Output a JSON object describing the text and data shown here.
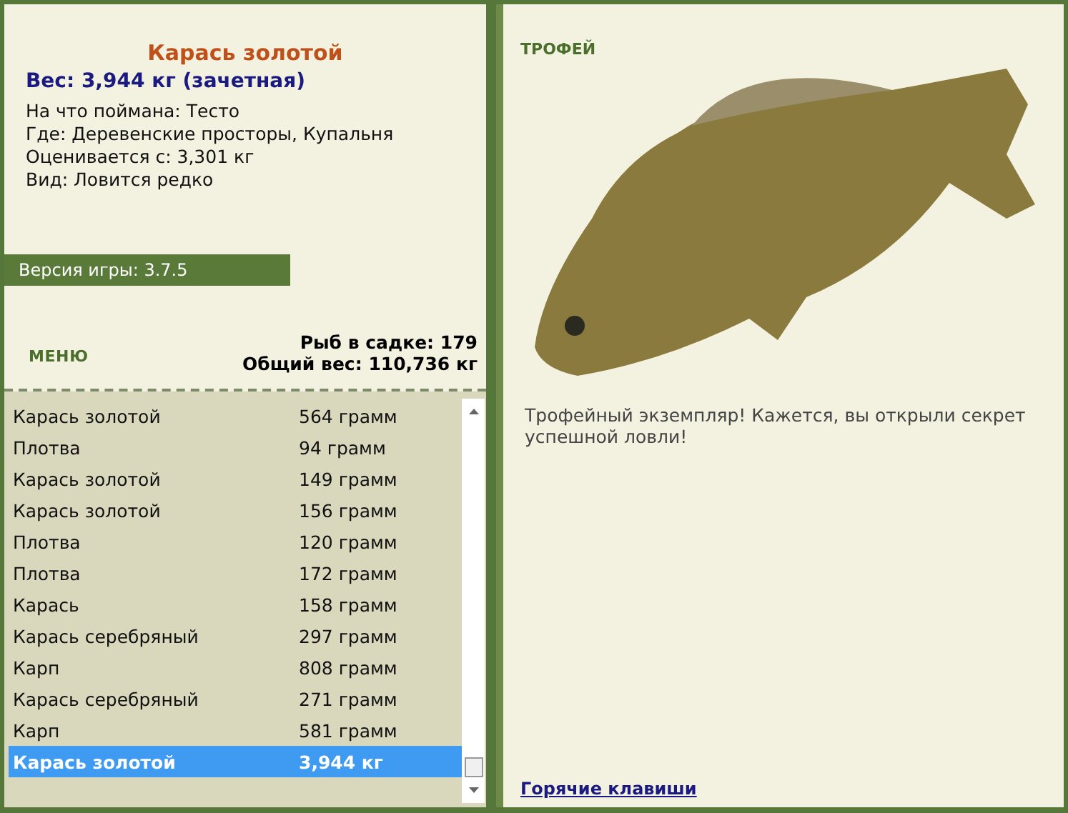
{
  "catch": {
    "title": "Карась золотой",
    "weight": "Вес: 3,944 кг (зачетная)",
    "details": [
      "На что поймана: Тесто",
      "Где: Деревенские просторы, Купальня",
      "Оценивается с: 3,301 кг",
      "Вид: Ловится редко"
    ]
  },
  "version": "Версия игры: 3.7.5",
  "menu_button": "МЕНЮ",
  "stats": [
    "Рыб в садке: 179",
    "Общий вес: 110,736 кг"
  ],
  "fish_list": [
    {
      "name": "Карась золотой",
      "weight": "564 грамм",
      "selected": false
    },
    {
      "name": "Плотва",
      "weight": "94 грамм",
      "selected": false
    },
    {
      "name": "Карась золотой",
      "weight": "149 грамм",
      "selected": false
    },
    {
      "name": "Карась золотой",
      "weight": "156 грамм",
      "selected": false
    },
    {
      "name": "Плотва",
      "weight": "120 грамм",
      "selected": false
    },
    {
      "name": "Плотва",
      "weight": "172 грамм",
      "selected": false
    },
    {
      "name": "Карась",
      "weight": "158 грамм",
      "selected": false
    },
    {
      "name": "Карась серебряный",
      "weight": "297 грамм",
      "selected": false
    },
    {
      "name": "Карп",
      "weight": "808 грамм",
      "selected": false
    },
    {
      "name": "Карась серебряный",
      "weight": "271 грамм",
      "selected": false
    },
    {
      "name": "Карп",
      "weight": "581 грамм",
      "selected": false
    },
    {
      "name": "Карась золотой",
      "weight": "3,944 кг",
      "selected": true
    }
  ],
  "trophy": {
    "heading": "ТРОФЕЙ",
    "message": "Трофейный экземпляр! Кажется, вы открыли секрет успешной ловли!",
    "hotkeys_link": "Горячие клавиши"
  }
}
